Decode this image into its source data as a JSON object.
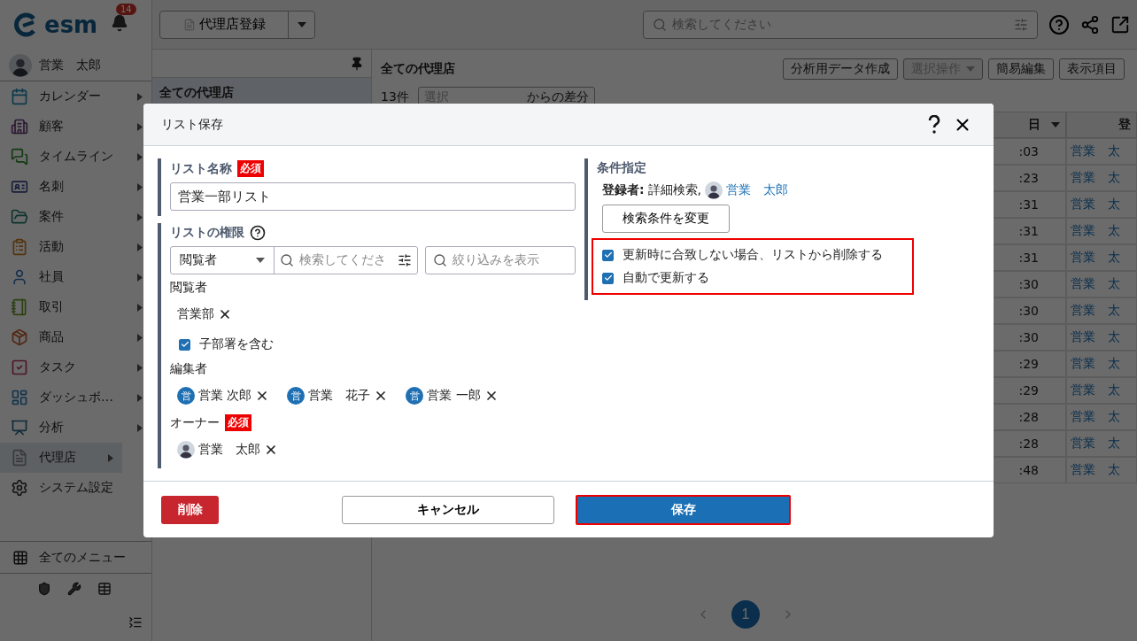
{
  "sidebar": {
    "logo": "esm",
    "notification_count": "14",
    "user": {
      "name": "営業　太郎"
    },
    "items": [
      {
        "label": "カレンダー",
        "kind": "calendar",
        "submenu": true,
        "selected": false
      },
      {
        "label": "顧客",
        "kind": "building",
        "submenu": true,
        "selected": false
      },
      {
        "label": "タイムライン",
        "kind": "chat",
        "submenu": true,
        "selected": false
      },
      {
        "label": "名刺",
        "kind": "card",
        "submenu": true,
        "selected": false
      },
      {
        "label": "案件",
        "kind": "folder",
        "submenu": true,
        "selected": false
      },
      {
        "label": "活動",
        "kind": "clipboard",
        "submenu": true,
        "selected": false
      },
      {
        "label": "社員",
        "kind": "person",
        "submenu": true,
        "selected": false
      },
      {
        "label": "取引",
        "kind": "notebook",
        "submenu": true,
        "selected": false
      },
      {
        "label": "商品",
        "kind": "box",
        "submenu": true,
        "selected": false
      },
      {
        "label": "タスク",
        "kind": "task",
        "submenu": true,
        "selected": false
      },
      {
        "label": "ダッシュボ…",
        "kind": "dashboard",
        "submenu": true,
        "selected": false
      },
      {
        "label": "分析",
        "kind": "chart",
        "submenu": true,
        "selected": false
      },
      {
        "label": "代理店",
        "kind": "document",
        "submenu": true,
        "selected": true
      },
      {
        "label": "システム設定",
        "kind": "gear",
        "submenu": false,
        "selected": false
      }
    ],
    "all_menu": "全てのメニュー"
  },
  "topbar": {
    "register_button": "代理店登録",
    "search": {
      "placeholder": "検索してください"
    }
  },
  "list_pane": {
    "items": [
      {
        "label": "全ての代理店",
        "selected": true
      }
    ]
  },
  "main": {
    "title": "全ての代理店",
    "buttons": [
      {
        "label": "分析用データ作成",
        "disabled": false,
        "dropdown": false
      },
      {
        "label": "選択操作",
        "disabled": true,
        "dropdown": true
      },
      {
        "label": "簡易編集",
        "disabled": false,
        "dropdown": false
      },
      {
        "label": "表示項目",
        "disabled": false,
        "dropdown": false
      }
    ],
    "count": "13件",
    "diff": {
      "placeholder": "選択",
      "suffix": "からの差分"
    },
    "table": {
      "columns": [
        "日",
        "登"
      ],
      "rows": [
        [
          ":03",
          "営業　太"
        ],
        [
          ":23",
          "営業　太"
        ],
        [
          ":31",
          "営業　太"
        ],
        [
          ":31",
          "営業　太"
        ],
        [
          ":31",
          "営業　太"
        ],
        [
          ":30",
          "営業　太"
        ],
        [
          ":30",
          "営業　太"
        ],
        [
          ":30",
          "営業　太"
        ],
        [
          ":29",
          "営業　太"
        ],
        [
          ":29",
          "営業　太"
        ],
        [
          ":28",
          "営業　太"
        ],
        [
          ":28",
          "営業　太"
        ],
        [
          ":48",
          "営業　太"
        ]
      ]
    },
    "pagination": {
      "pages": [
        {
          "label": "1",
          "selected": true
        }
      ]
    }
  },
  "dialog": {
    "title": "リスト保存",
    "name_section": {
      "label": "リスト名称",
      "required": "必須",
      "value": "営業一部リスト"
    },
    "permission_section": {
      "label": "リストの権限",
      "role_select": "閲覧者",
      "search": {
        "placeholder": "検索してくださ"
      },
      "filter": {
        "placeholder": "絞り込みを表示"
      },
      "viewers": {
        "label": "閲覧者",
        "items": [
          {
            "name": "営業部"
          }
        ],
        "include_sub": {
          "label": "子部署を含む",
          "checked": true
        }
      },
      "editors": {
        "label": "編集者",
        "items": [
          {
            "initial": "営",
            "name": "営業 次郎"
          },
          {
            "initial": "営",
            "name": "営業　花子"
          },
          {
            "initial": "営",
            "name": "営業 一郎"
          }
        ]
      },
      "owner": {
        "label": "オーナー",
        "required": "必須",
        "items": [
          {
            "name": "営業　太郎"
          }
        ]
      }
    },
    "condition_section": {
      "label": "条件指定",
      "registrant_label": "登録者:",
      "registrant_text": "詳細検索,",
      "registrant_name": "営業　太郎",
      "change_button": "検索条件を変更",
      "options": [
        {
          "label": "更新時に合致しない場合、リストから削除する",
          "checked": true
        },
        {
          "label": "自動で更新する",
          "checked": true
        }
      ],
      "highlighted": true
    },
    "footer": {
      "delete": "削除",
      "cancel": "キャンセル",
      "save": "保存",
      "save_highlighted": true
    }
  }
}
